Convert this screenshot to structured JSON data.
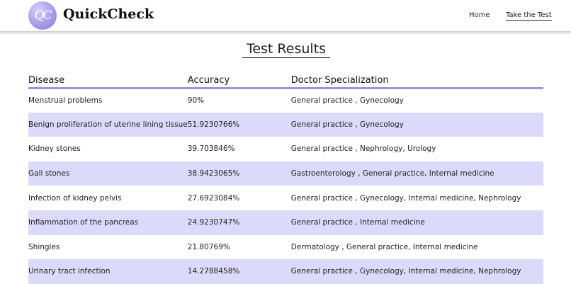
{
  "navbar": {
    "logo_text": "QC",
    "brand": "QuickCheck",
    "links": [
      {
        "label": "Home"
      },
      {
        "label": "Take the Test"
      }
    ]
  },
  "page": {
    "title": "Test Results"
  },
  "table": {
    "headers": [
      "Disease",
      "Accuracy",
      "Doctor Specialization"
    ],
    "rows": [
      {
        "disease": "Menstrual problems",
        "accuracy": "90%",
        "specialization": "General practice , Gynecology"
      },
      {
        "disease": "Benign proliferation of uterine lining tissue",
        "accuracy": "51.9230766%",
        "specialization": "General practice , Gynecology"
      },
      {
        "disease": "Kidney stones",
        "accuracy": "39.703846%",
        "specialization": "General practice , Nephrology, Urology"
      },
      {
        "disease": "Gall stones",
        "accuracy": "38.9423065%",
        "specialization": "Gastroenterology , General practice, Internal medicine"
      },
      {
        "disease": "Infection of kidney pelvis",
        "accuracy": "27.6923084%",
        "specialization": "General practice , Gynecology, Internal medicine, Nephrology"
      },
      {
        "disease": "Inflammation of the pancreas",
        "accuracy": "24.9230747%",
        "specialization": "General practice , Internal medicine"
      },
      {
        "disease": "Shingles",
        "accuracy": "21.80769%",
        "specialization": "Dermatology , General practice, Internal medicine"
      },
      {
        "disease": "Urinary tract infection",
        "accuracy": "14.2788458%",
        "specialization": "General practice , Gynecology, Internal medicine, Nephrology"
      }
    ]
  },
  "colors": {
    "accent": "#9b93dc",
    "row_shade": "#dcdafa"
  }
}
